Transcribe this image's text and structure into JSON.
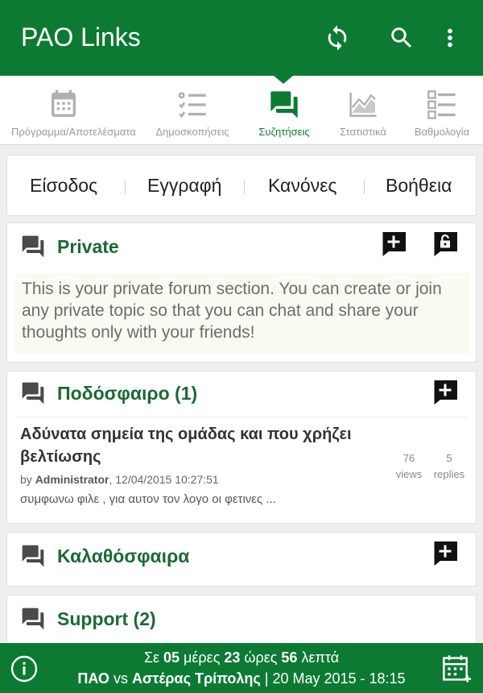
{
  "app": {
    "title": "PAO Links"
  },
  "icons": {
    "refresh": "refresh-icon",
    "search": "search-icon",
    "more": "more-vert-icon"
  },
  "tabs": [
    {
      "label": "Πρόγραμμα/Αποτελέσματα",
      "icon": "calendar-icon",
      "active": false
    },
    {
      "label": "Δημοσκοπήσεις",
      "icon": "checklist-icon",
      "active": false
    },
    {
      "label": "Συζητήσεις",
      "icon": "forum-icon",
      "active": true
    },
    {
      "label": "Στατιστικά",
      "icon": "area-chart-icon",
      "active": false
    },
    {
      "label": "Βαθμολογία",
      "icon": "ranking-list-icon",
      "active": false
    }
  ],
  "menu": {
    "login": "Είσοδος",
    "register": "Εγγραφή",
    "rules": "Κανόνες",
    "help": "Βοήθεια"
  },
  "private": {
    "title": "Private",
    "description": "This is your private forum section. You can create or join any private topic so that you can chat and share your thoughts only with your friends!"
  },
  "football": {
    "title": "Ποδόσφαιρο (1)",
    "topic": {
      "title": "Αδύνατα σημεία της ομάδας και που χρήζει βελτίωσης",
      "by_prefix": "by ",
      "author": "Administrator",
      "date": ", 12/04/2015 10:27:51",
      "excerpt": "συμφωνω φιλε , για αυτον τον λογο οι φετινες  ...",
      "views": "76",
      "views_label": "views",
      "replies": "5",
      "replies_label": "replies"
    }
  },
  "basketball": {
    "title": "Καλαθόσφαιρα"
  },
  "support": {
    "title": "Support (2)"
  },
  "countdown": {
    "prefix": "Σε ",
    "days": "05",
    "days_label": " μέρες ",
    "hours": "23",
    "hours_label": " ώρες ",
    "minutes": "56",
    "minutes_label": " λεπτά",
    "home": "ΠΑΟ",
    "vs": " vs ",
    "away": "Αστέρας Τρίπολης",
    "date": " | 20 May 2015 - 18:15"
  },
  "colors": {
    "brand": "#0d7a34",
    "section_title": "#1a6a34",
    "tab_inactive": "#9a9a9a"
  }
}
